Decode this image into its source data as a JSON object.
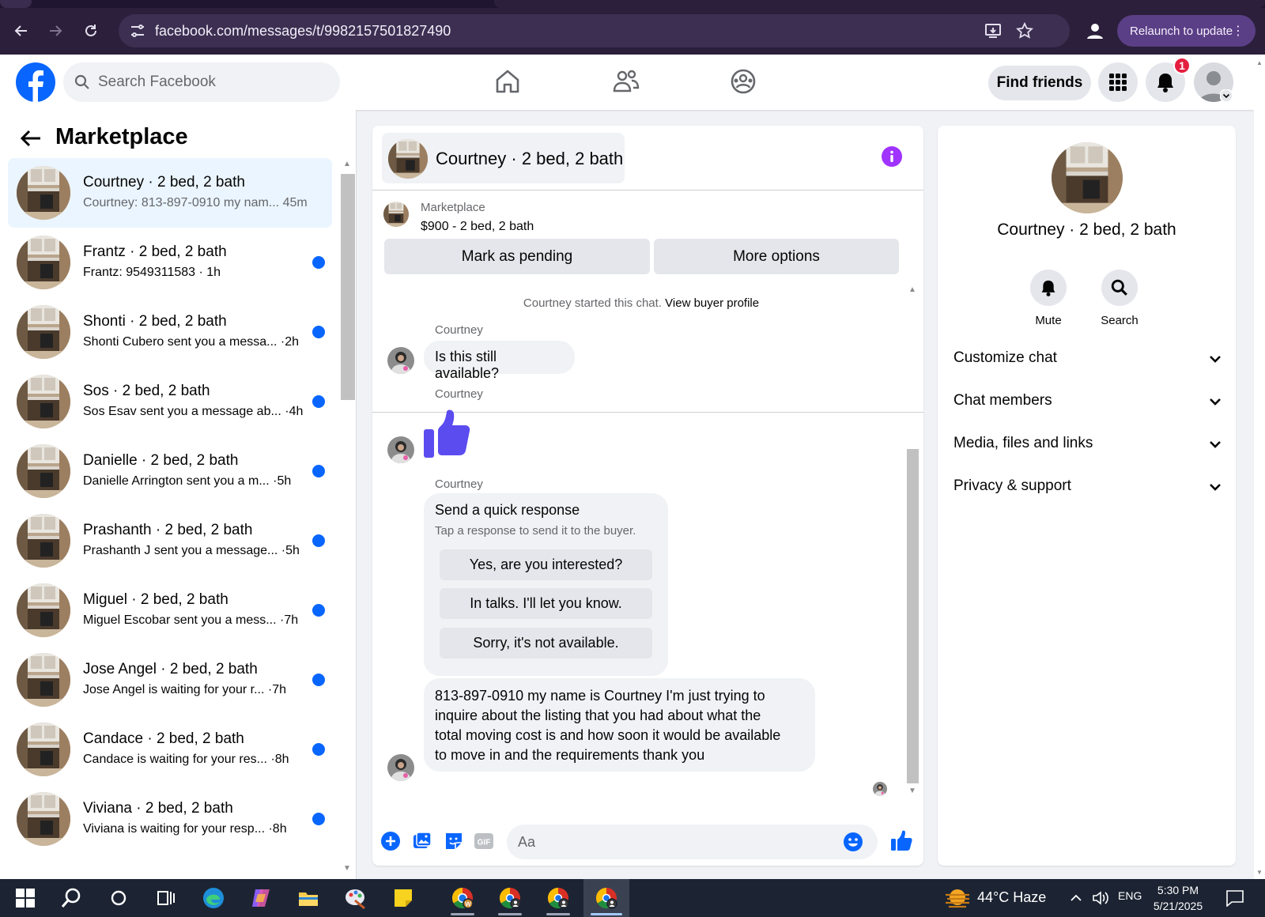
{
  "browser": {
    "url": "facebook.com/messages/t/9982157501827490",
    "relaunch_label": "Relaunch to update",
    "menu_glyph": "⋮"
  },
  "fb": {
    "search_placeholder": "Search Facebook",
    "find_friends": "Find friends",
    "notification_count": "1",
    "brand_color": "#0866ff"
  },
  "left": {
    "title": "Marketplace",
    "conversations": [
      {
        "name": "Courtney · 2 bed, 2 bath",
        "preview": "Courtney: 813-897-0910 my nam...  45m",
        "unread": false,
        "selected": true
      },
      {
        "name": "Frantz · 2 bed, 2 bath",
        "preview": "Frantz: 9549311583 · 1h",
        "unread": true,
        "selected": false
      },
      {
        "name": "Shonti · 2 bed, 2 bath",
        "preview": "Shonti Cubero sent you a messa... ·2h",
        "unread": true,
        "selected": false
      },
      {
        "name": "Sos · 2 bed, 2 bath",
        "preview": "Sos Esav sent you a message ab... ·4h",
        "unread": true,
        "selected": false
      },
      {
        "name": "Danielle · 2 bed, 2 bath",
        "preview": "Danielle Arrington sent you a m... ·5h",
        "unread": true,
        "selected": false
      },
      {
        "name": "Prashanth · 2 bed, 2 bath",
        "preview": "Prashanth J sent you a message... ·5h",
        "unread": true,
        "selected": false
      },
      {
        "name": "Miguel · 2 bed, 2 bath",
        "preview": "Miguel Escobar sent you a mess... ·7h",
        "unread": true,
        "selected": false
      },
      {
        "name": "Jose Angel · 2 bed, 2 bath",
        "preview": "Jose Angel is waiting for your r... ·7h",
        "unread": true,
        "selected": false
      },
      {
        "name": "Candace · 2 bed, 2 bath",
        "preview": "Candace is waiting for your res... ·8h",
        "unread": true,
        "selected": false
      },
      {
        "name": "Viviana · 2 bed, 2 bath",
        "preview": "Viviana is waiting for your resp... ·8h",
        "unread": true,
        "selected": false
      }
    ]
  },
  "chat": {
    "title": "Courtney · 2 bed, 2 bath",
    "listing": {
      "source": "Marketplace",
      "price_desc": "$900 - 2 bed, 2 bath"
    },
    "mark_pending": "Mark as pending",
    "more_options": "More options",
    "started_text": "Courtney started this chat.",
    "view_profile": "View buyer profile",
    "sender": "Courtney",
    "msg1": "Is this still available?",
    "quick": {
      "heading": "Send a quick response",
      "sub": "Tap a response to send it to the buyer.",
      "options": [
        "Yes, are you interested?",
        "In talks. I'll let you know.",
        "Sorry, it's not available."
      ]
    },
    "msg_long": [
      "813-897-0910 my name is Courtney I'm just trying to",
      "inquire about the listing that you had about what the",
      "total moving cost is and how soon it would be available",
      "to move in and the requirements thank you"
    ],
    "composer_placeholder": "Aa"
  },
  "right": {
    "name": "Courtney · 2 bed, 2 bath",
    "mute": "Mute",
    "search": "Search",
    "sections": [
      "Customize chat",
      "Chat members",
      "Media, files and links",
      "Privacy & support"
    ]
  },
  "taskbar": {
    "weather": "44°C  Haze",
    "lang": "ENG",
    "time": "5:30 PM",
    "date": "5/21/2025"
  }
}
